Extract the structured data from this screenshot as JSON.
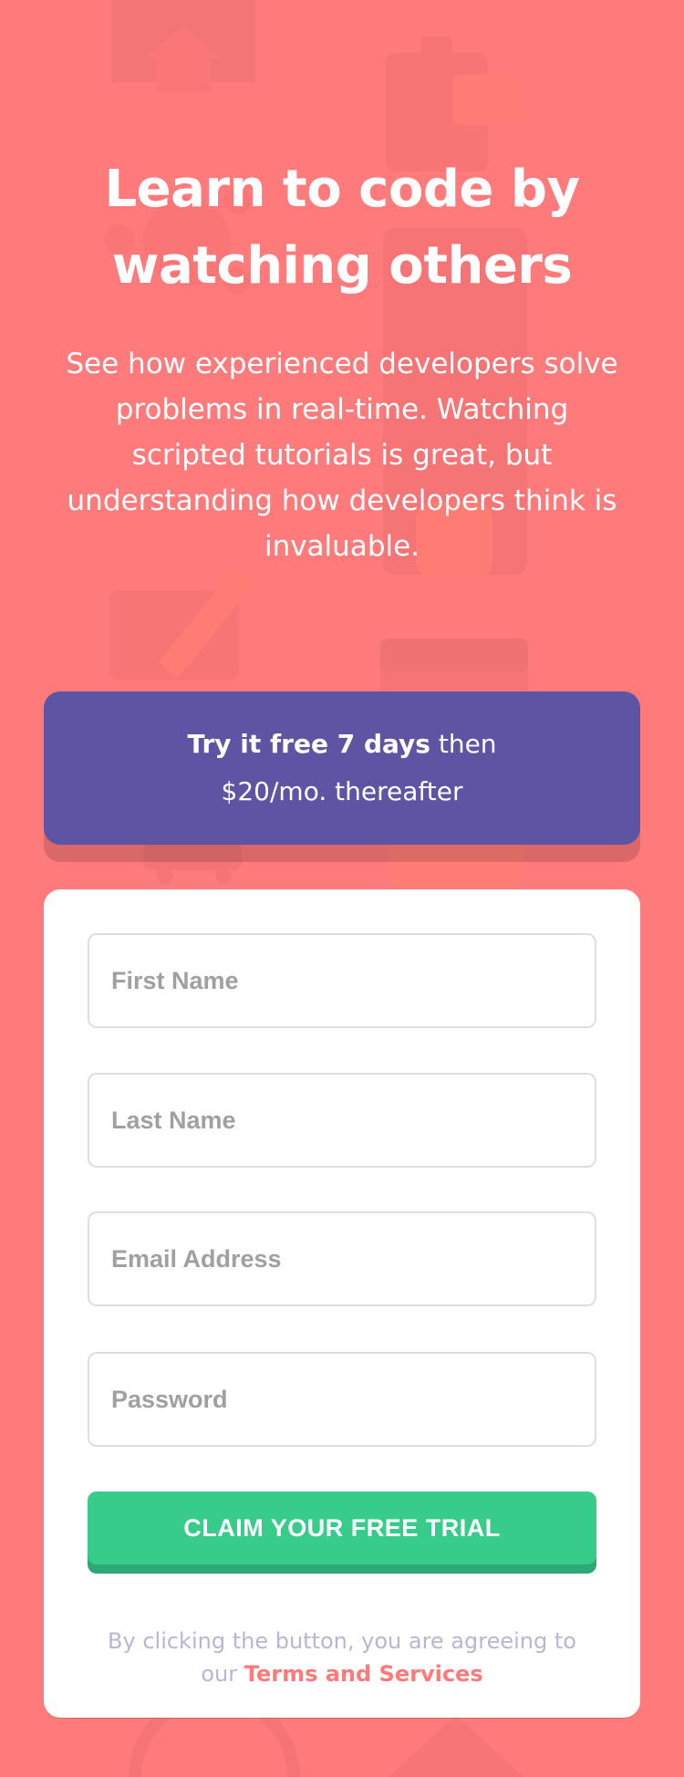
{
  "colors": {
    "background": "#ff7a7a",
    "promo_background": "#5e54a4",
    "card_background": "#ffffff",
    "button_background": "#38cc8b",
    "button_shadow": "#2fa876",
    "placeholder_text": "#a0a0a0",
    "terms_text": "#b9b6d3",
    "terms_link": "#ff7a7a"
  },
  "icons": {
    "background_pattern": "coding-pattern-icons"
  },
  "hero": {
    "title": "Learn to code by watching others",
    "description": "See how experienced developers solve problems in real-time. Watching scripted tutorials is great, but understanding how developers think is invaluable."
  },
  "promo": {
    "strong": "Try it free 7 days",
    "suffix": "then",
    "line2": "$20/mo. thereafter"
  },
  "form": {
    "first_name_placeholder": "First Name",
    "last_name_placeholder": "Last Name",
    "email_placeholder": "Email Address",
    "password_placeholder": "Password",
    "submit_label": "CLAIM YOUR FREE TRIAL",
    "terms_prefix": "By clicking the button, you are agreeing to our",
    "terms_link": "Terms and Services"
  }
}
